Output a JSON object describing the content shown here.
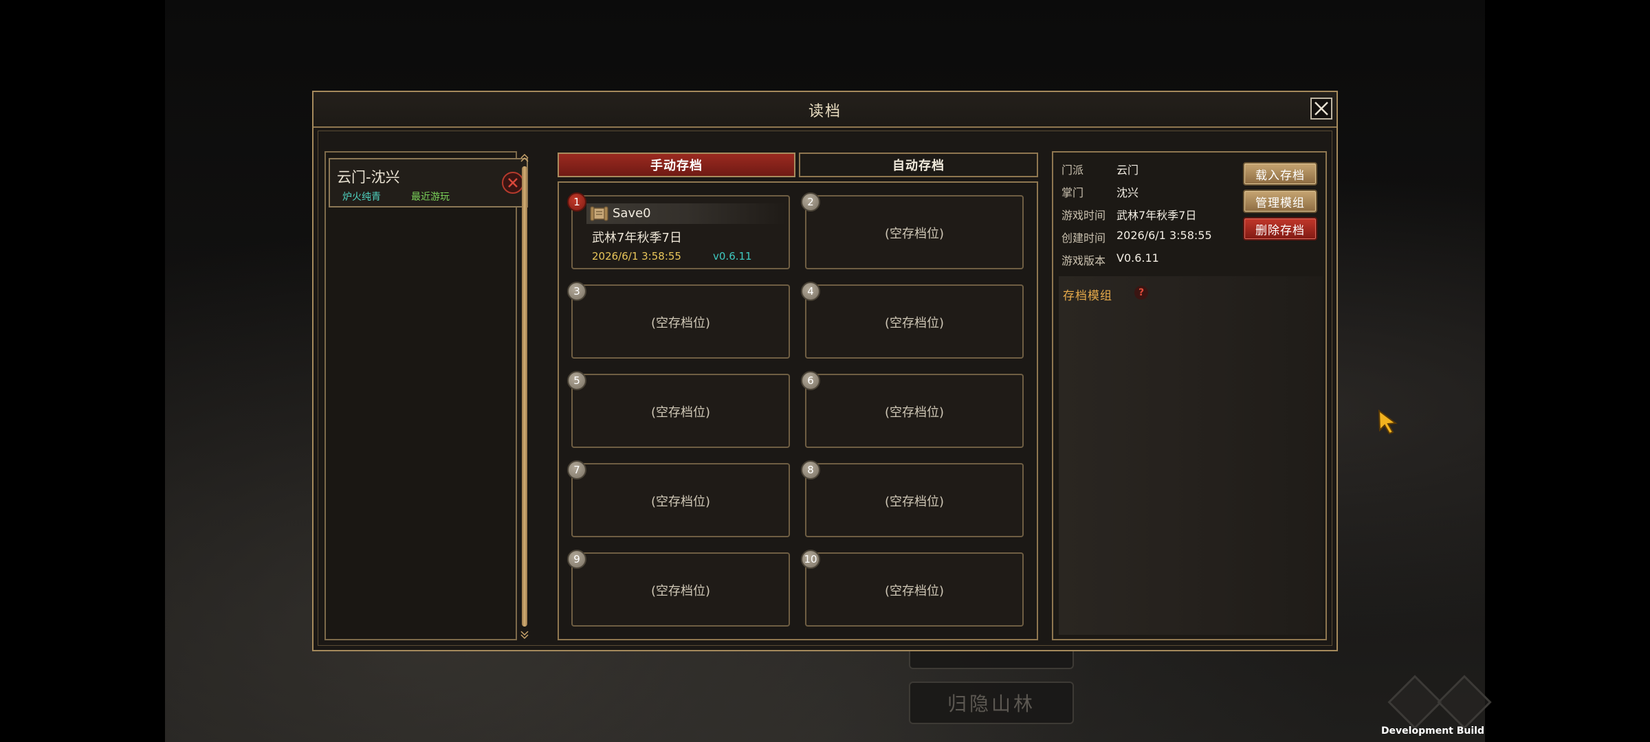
{
  "background": {
    "menu_partial_label": "",
    "menu_button_label": "归隐山林",
    "dev_build": "Development Build"
  },
  "dialog": {
    "title": "读档"
  },
  "profile": {
    "name": "云门-沈兴",
    "tag1": "炉火纯青",
    "tag2": "最近游玩"
  },
  "tabs": {
    "manual": "手动存档",
    "auto": "自动存档"
  },
  "slots": [
    {
      "num": "1",
      "name": "Save0",
      "date": "武林7年秋季7日",
      "time": "2026/6/1 3:58:55",
      "version": "v0.6.11"
    },
    {
      "num": "2",
      "empty": "(空存档位)"
    },
    {
      "num": "3",
      "empty": "(空存档位)"
    },
    {
      "num": "4",
      "empty": "(空存档位)"
    },
    {
      "num": "5",
      "empty": "(空存档位)"
    },
    {
      "num": "6",
      "empty": "(空存档位)"
    },
    {
      "num": "7",
      "empty": "(空存档位)"
    },
    {
      "num": "8",
      "empty": "(空存档位)"
    },
    {
      "num": "9",
      "empty": "(空存档位)"
    },
    {
      "num": "10",
      "empty": "(空存档位)"
    }
  ],
  "info": {
    "rows": [
      {
        "label": "门派",
        "value": "云门"
      },
      {
        "label": "掌门",
        "value": "沈兴"
      },
      {
        "label": "游戏时间",
        "value": "武林7年秋季7日"
      },
      {
        "label": "创建时间",
        "value": "2026/6/1 3:58:55"
      },
      {
        "label": "游戏版本",
        "value": "V0.6.11"
      }
    ],
    "buttons": {
      "load": "载入存档",
      "manage": "管理模组",
      "delete": "删除存档"
    },
    "mod_title": "存档模组",
    "mod_help": "?"
  },
  "colors": {
    "accent_gold": "#a58a5c",
    "active_tab_red": "#9b2a20",
    "time_yellow": "#e8c55a",
    "version_cyan": "#3fc9c0",
    "tag_cyan": "#4fd2c0",
    "tag_green": "#7bd35a",
    "mod_title_orange": "#e5a94a"
  },
  "icons": {
    "close": "close-icon",
    "profile_delete": "delete-circle-icon",
    "save_scroll": "scroll-icon",
    "help": "help-icon",
    "cursor": "cursor-arrow-icon"
  }
}
